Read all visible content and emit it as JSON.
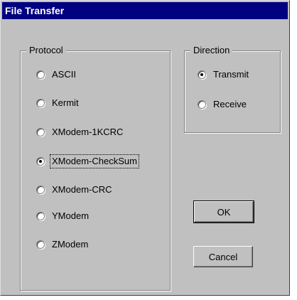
{
  "dialog": {
    "title": "File Transfer"
  },
  "protocol": {
    "label": "Protocol",
    "options": [
      {
        "label": "ASCII",
        "checked": false
      },
      {
        "label": "Kermit",
        "checked": false
      },
      {
        "label": "XModem-1KCRC",
        "checked": false
      },
      {
        "label": "XModem-CheckSum",
        "checked": true,
        "focused": true
      },
      {
        "label": "XModem-CRC",
        "checked": false
      },
      {
        "label": "YModem",
        "checked": false
      },
      {
        "label": "ZModem",
        "checked": false
      }
    ]
  },
  "direction": {
    "label": "Direction",
    "options": [
      {
        "label": "Transmit",
        "checked": true
      },
      {
        "label": "Receive",
        "checked": false
      }
    ]
  },
  "buttons": {
    "ok": "OK",
    "cancel": "Cancel"
  }
}
